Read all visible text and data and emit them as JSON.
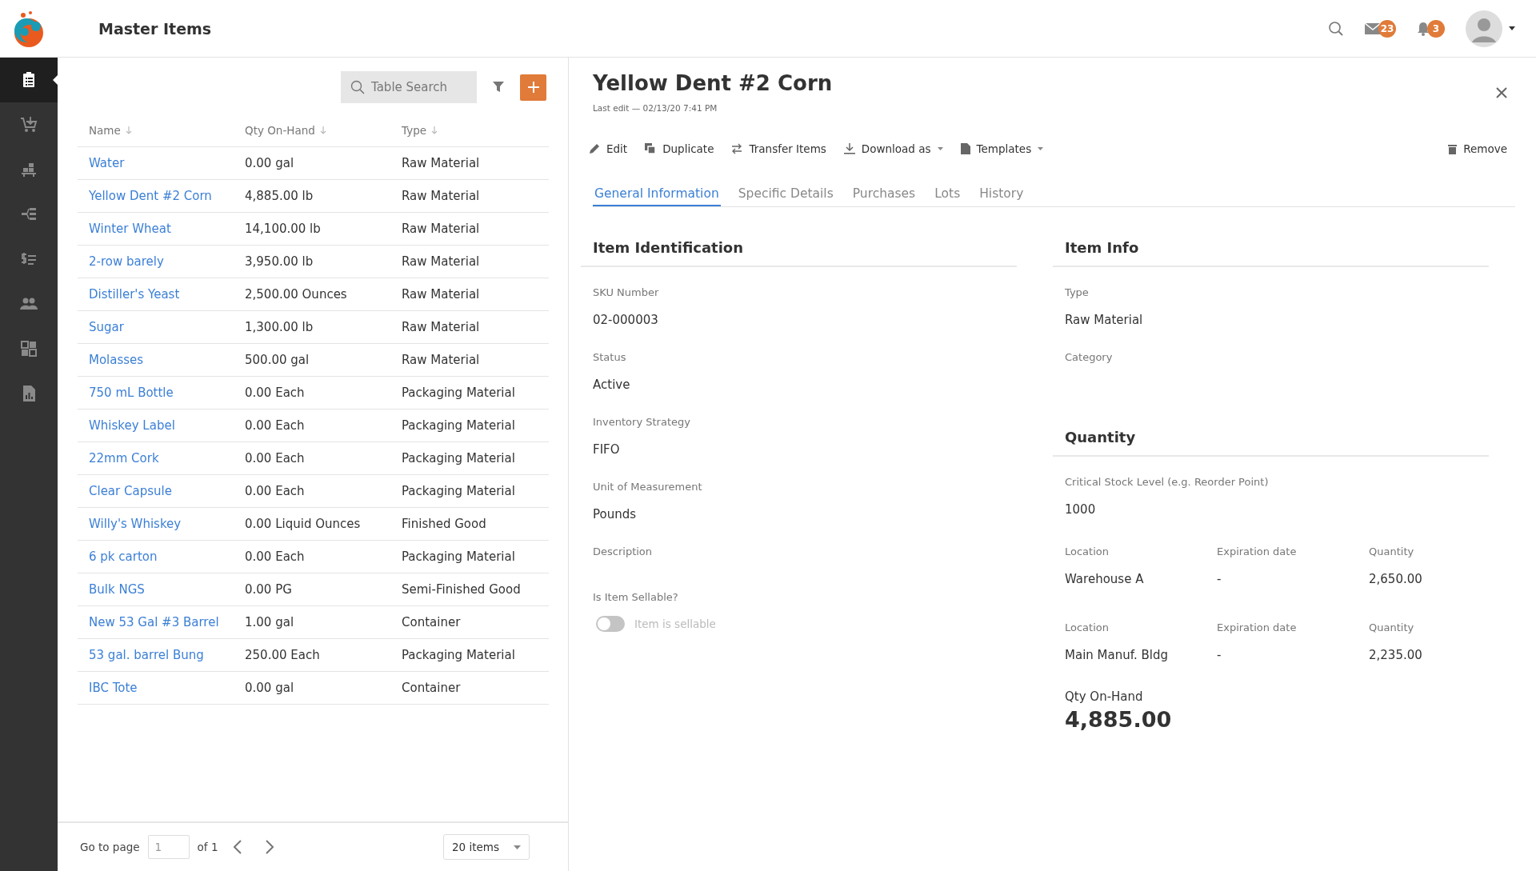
{
  "header": {
    "title": "Master Items",
    "mail_count": "23",
    "notification_count": "3"
  },
  "sidebar": {
    "items": [
      {
        "selected": true
      },
      {
        "selected": false
      },
      {
        "selected": false
      },
      {
        "selected": false
      },
      {
        "selected": false
      },
      {
        "selected": false
      },
      {
        "selected": false
      },
      {
        "selected": false
      }
    ]
  },
  "list_panel": {
    "search": {
      "placeholder": "Table Search"
    },
    "table": {
      "columns": [
        "Name",
        "Qty On-Hand",
        "Type"
      ],
      "rows": [
        {
          "name": "Water",
          "qty": "0.00 gal",
          "type": "Raw Material"
        },
        {
          "name": "Yellow Dent #2 Corn",
          "qty": "4,885.00 lb",
          "type": "Raw Material"
        },
        {
          "name": "Winter Wheat",
          "qty": "14,100.00 lb",
          "type": "Raw Material"
        },
        {
          "name": "2-row barely",
          "qty": "3,950.00 lb",
          "type": "Raw Material"
        },
        {
          "name": "Distiller's Yeast",
          "qty": "2,500.00 Ounces",
          "type": "Raw Material"
        },
        {
          "name": "Sugar",
          "qty": "1,300.00 lb",
          "type": "Raw Material"
        },
        {
          "name": "Molasses",
          "qty": "500.00 gal",
          "type": "Raw Material"
        },
        {
          "name": "750 mL Bottle",
          "qty": "0.00 Each",
          "type": "Packaging Material"
        },
        {
          "name": "Whiskey Label",
          "qty": "0.00 Each",
          "type": "Packaging Material"
        },
        {
          "name": "22mm Cork",
          "qty": "0.00 Each",
          "type": "Packaging Material"
        },
        {
          "name": "Clear Capsule",
          "qty": "0.00 Each",
          "type": "Packaging Material"
        },
        {
          "name": "Willy's Whiskey",
          "qty": "0.00 Liquid Ounces",
          "type": "Finished Good"
        },
        {
          "name": "6 pk carton",
          "qty": "0.00 Each",
          "type": "Packaging Material"
        },
        {
          "name": "Bulk NGS",
          "qty": "0.00 PG",
          "type": "Semi-Finished Good"
        },
        {
          "name": "New 53 Gal #3 Barrel",
          "qty": "1.00 gal",
          "type": "Container"
        },
        {
          "name": "53 gal. barrel Bung",
          "qty": "250.00 Each",
          "type": "Packaging Material"
        },
        {
          "name": "IBC Tote",
          "qty": "0.00 gal",
          "type": "Container"
        }
      ]
    },
    "pagination": {
      "label": "Go to page",
      "page": "1",
      "of": "of 1",
      "page_size": "20 items"
    }
  },
  "detail": {
    "title": "Yellow Dent #2 Corn",
    "last_edit": "Last edit — 02/13/20 7:41 PM",
    "actions": [
      {
        "kind": "edit",
        "label": "Edit"
      },
      {
        "kind": "duplicate",
        "label": "Duplicate"
      },
      {
        "kind": "transfer",
        "label": "Transfer Items"
      },
      {
        "kind": "download",
        "label": "Download as"
      },
      {
        "kind": "templates",
        "label": "Templates"
      }
    ],
    "remove": "Remove",
    "tabs": [
      {
        "label": "General Information",
        "selected": true
      },
      {
        "label": "Specific Details",
        "selected": false
      },
      {
        "label": "Purchases",
        "selected": false
      },
      {
        "label": "Lots",
        "selected": false
      },
      {
        "label": "History",
        "selected": false
      }
    ],
    "identification": {
      "title": "Item Identification",
      "fields": [
        {
          "label": "SKU Number",
          "value": "02-000003"
        },
        {
          "label": "Status",
          "value": "Active"
        },
        {
          "label": "Inventory Strategy",
          "value": "FIFO"
        },
        {
          "label": "Unit of Measurement",
          "value": "Pounds"
        },
        {
          "label": "Description"
        }
      ],
      "sellable": {
        "label": "Is Item Sellable?",
        "toggle_label": "Item is sellable",
        "on": false
      }
    },
    "item_info": {
      "title": "Item Info",
      "fields": [
        {
          "label": "Type",
          "value": "Raw Material"
        },
        {
          "label": "Category"
        }
      ]
    },
    "quantity": {
      "title": "Quantity",
      "critical": {
        "label": "Critical Stock Level (e.g. Reorder Point)",
        "value": "1000"
      },
      "locations": [
        {
          "location_label": "Location",
          "location": "Warehouse A",
          "expiration_label": "Expiration date",
          "expiration": "-",
          "quantity_label": "Quantity",
          "quantity": "2,650.00"
        },
        {
          "location_label": "Location",
          "location": "Main Manuf. Bldg",
          "expiration_label": "Expiration date",
          "expiration": "-",
          "quantity_label": "Quantity",
          "quantity": "2,235.00"
        }
      ],
      "total_label": "Qty On-Hand",
      "total": "4,885.00"
    }
  }
}
